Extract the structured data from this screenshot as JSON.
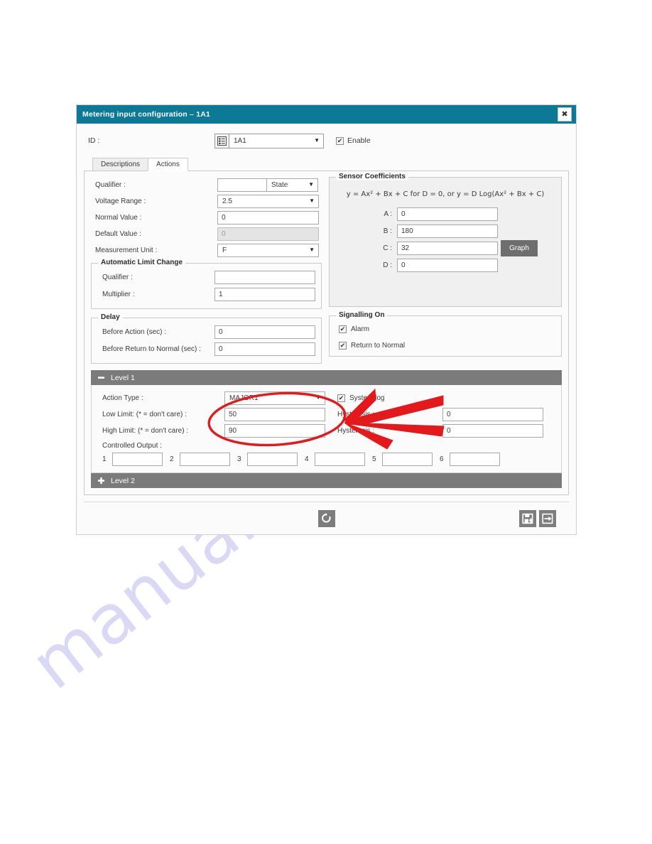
{
  "dialog": {
    "title": "Metering input configuration – 1A1",
    "close_label": "✖"
  },
  "id_row": {
    "label": "ID :",
    "picker_icon": "list-grid-icon",
    "value": "1A1",
    "enable_label": "Enable",
    "enable_checked": "✔"
  },
  "tabs": [
    {
      "label": "Descriptions",
      "active": false
    },
    {
      "label": "Actions",
      "active": true
    }
  ],
  "actions": {
    "qualifier": {
      "label": "Qualifier :",
      "value": "",
      "select_value": "State"
    },
    "voltage_range": {
      "label": "Voltage Range :",
      "value": "2.5"
    },
    "normal_value": {
      "label": "Normal Value :",
      "value": "0"
    },
    "default_value": {
      "label": "Default Value :",
      "value": "0"
    },
    "measurement_unit": {
      "label": "Measurement Unit :",
      "value": "F"
    },
    "automatic_limit_change": {
      "legend": "Automatic Limit Change",
      "qualifier": {
        "label": "Qualifier :",
        "value": ""
      },
      "multiplier": {
        "label": "Multiplier :",
        "value": "1"
      }
    },
    "delay": {
      "legend": "Delay",
      "before_action": {
        "label": "Before Action (sec) :",
        "value": "0"
      },
      "before_return": {
        "label": "Before Return to Normal (sec) :",
        "value": "0"
      }
    }
  },
  "sensor_coefficients": {
    "legend": "Sensor Coefficients",
    "formula": "y = Ax² + Bx + C for D = 0, or y = D Log(Ax² + Bx + C)",
    "rows": [
      {
        "label": "A :",
        "value": "0"
      },
      {
        "label": "B :",
        "value": "180"
      },
      {
        "label": "C :",
        "value": "32"
      },
      {
        "label": "D :",
        "value": "0"
      }
    ],
    "graph_button": "Graph"
  },
  "signalling_on": {
    "legend": "Signalling On",
    "items": [
      {
        "label": "Alarm",
        "checked": "✔"
      },
      {
        "label": "Return to Normal",
        "checked": "✔"
      }
    ]
  },
  "level1": {
    "title": "Level 1",
    "toggle_icon": "minus-icon",
    "action_type": {
      "label": "Action Type :",
      "value": "MAJOR1"
    },
    "system_log": {
      "label": "System log",
      "checked": "✔"
    },
    "low_limit": {
      "label": "Low Limit: (* = don't care) :",
      "value": "50"
    },
    "high_limit": {
      "label": "High Limit: (* = don't care) :",
      "value": "90"
    },
    "hysteresis_1": {
      "label": "Hysteresis :",
      "value": "0"
    },
    "hysteresis_2": {
      "label": "Hysteresis :",
      "value": "0"
    },
    "controlled_output": {
      "label": "Controlled Output :",
      "cells": [
        {
          "num": "1",
          "value": ""
        },
        {
          "num": "2",
          "value": ""
        },
        {
          "num": "3",
          "value": ""
        },
        {
          "num": "4",
          "value": ""
        },
        {
          "num": "5",
          "value": ""
        },
        {
          "num": "6",
          "value": ""
        }
      ]
    }
  },
  "level2": {
    "title": "Level 2",
    "toggle_icon": "plus-icon"
  },
  "footer": {
    "refresh_icon": "refresh-icon",
    "save_icon": "save-icon",
    "apply_exit_icon": "exit-icon"
  },
  "watermark": {
    "text": "manualshive.com"
  },
  "colors": {
    "title_bar": "#0c7a96",
    "level_bar": "#7b7b7b",
    "graph_button": "#6e6e6e",
    "annotation": "#e3191c",
    "watermark": "#d9d9f5"
  }
}
